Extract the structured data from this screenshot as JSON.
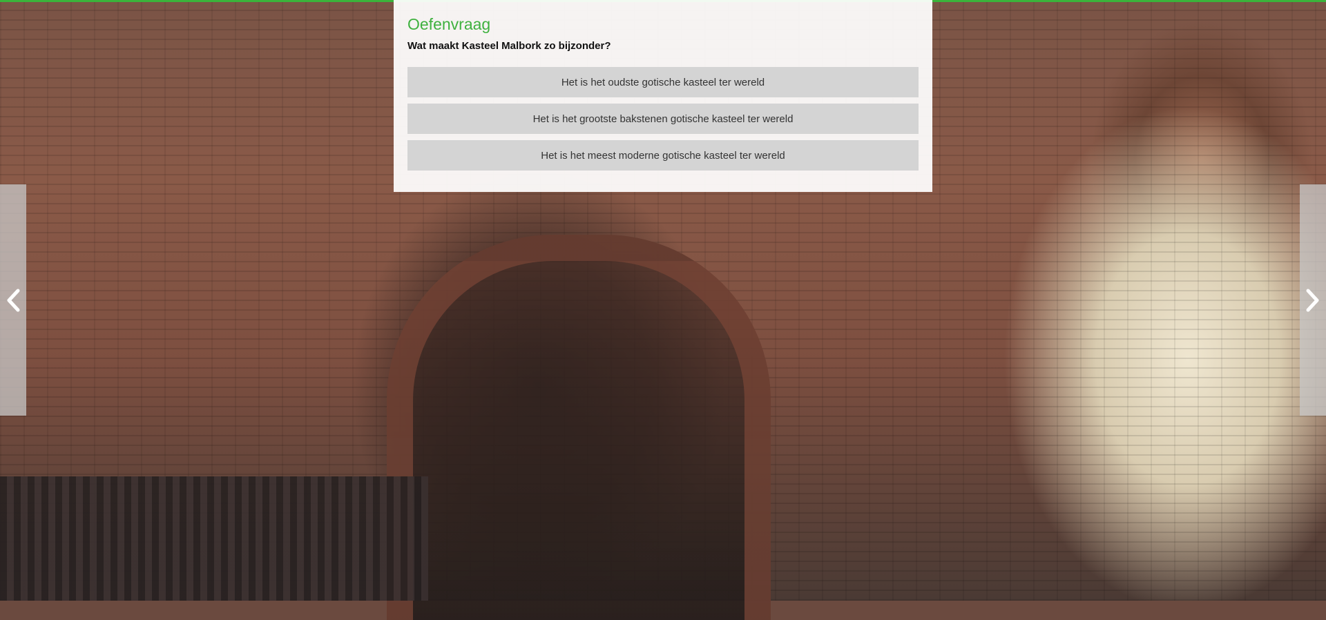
{
  "quiz": {
    "title": "Oefenvraag",
    "question": "Wat maakt Kasteel Malbork zo bijzonder?",
    "answers": [
      "Het is het oudste gotische kasteel ter wereld",
      "Het is het grootste bakstenen gotische kasteel ter wereld",
      "Het is het meest moderne gotische kasteel ter wereld"
    ]
  },
  "navigation": {
    "prev_icon": "chevron-left-icon",
    "next_icon": "chevron-right-icon"
  },
  "colors": {
    "accent": "#3fb13f",
    "answer_bg": "#d4d4d4"
  }
}
